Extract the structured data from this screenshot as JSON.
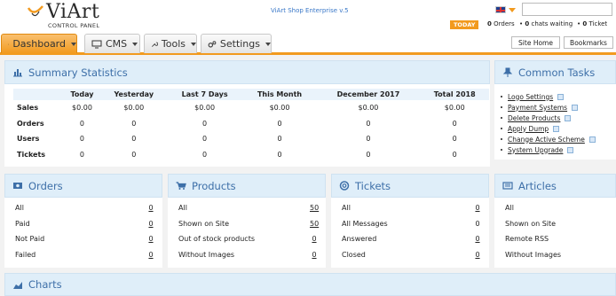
{
  "header": {
    "logo_text": "ViArt",
    "logo_sub": "CONTROL PANEL",
    "edition": "ViArt Shop Enterprise v.5",
    "search_placeholder": "",
    "today_badge": "TODAY",
    "orders_count": "0",
    "orders_label": "Orders",
    "chats_count": "0",
    "chats_label": "chats waiting",
    "tickets_count": "0",
    "tickets_label": "Ticket",
    "site_home": "Site Home",
    "bookmarks": "Bookmarks",
    "accent_color": "#f29a1e"
  },
  "nav": {
    "tabs": [
      {
        "label": "Dashboard",
        "icon": "home-icon"
      },
      {
        "label": "CMS",
        "icon": "monitor-icon"
      },
      {
        "label": "Tools",
        "icon": "wrench-icon"
      },
      {
        "label": "Settings",
        "icon": "gears-icon"
      }
    ]
  },
  "summary": {
    "title": "Summary Statistics",
    "columns": [
      "Today",
      "Yesterday",
      "Last 7 Days",
      "This Month",
      "December 2017",
      "Total 2018"
    ],
    "rows": [
      {
        "label": "Sales",
        "values": [
          "$0.00",
          "$0.00",
          "$0.00",
          "$0.00",
          "$0.00",
          "$0.00"
        ]
      },
      {
        "label": "Orders",
        "values": [
          "0",
          "0",
          "0",
          "0",
          "0",
          "0"
        ]
      },
      {
        "label": "Users",
        "values": [
          "0",
          "0",
          "0",
          "0",
          "0",
          "0"
        ]
      },
      {
        "label": "Tickets",
        "values": [
          "0",
          "0",
          "0",
          "0",
          "0",
          "0"
        ]
      }
    ]
  },
  "tasks": {
    "title": "Common Tasks",
    "items": [
      "Logo Settings",
      "Payment Systems",
      "Delete Products",
      "Apply Dump",
      "Change Active Scheme",
      "System Upgrade"
    ]
  },
  "orders": {
    "title": "Orders",
    "rows": [
      {
        "label": "All",
        "value": "0"
      },
      {
        "label": "Paid",
        "value": "0"
      },
      {
        "label": "Not Paid",
        "value": "0"
      },
      {
        "label": "Failed",
        "value": "0"
      }
    ]
  },
  "products": {
    "title": "Products",
    "rows": [
      {
        "label": "All",
        "value": "50"
      },
      {
        "label": "Shown on Site",
        "value": "50"
      },
      {
        "label": "Out of stock products",
        "value": "0"
      },
      {
        "label": "Without Images",
        "value": "0"
      }
    ]
  },
  "tickets": {
    "title": "Tickets",
    "rows": [
      {
        "label": "All",
        "value": "0"
      },
      {
        "label": "All Messages",
        "value": "0"
      },
      {
        "label": "Answered",
        "value": "0"
      },
      {
        "label": "Closed",
        "value": "0"
      }
    ]
  },
  "articles": {
    "title": "Articles",
    "rows": [
      {
        "label": "All"
      },
      {
        "label": "Shown on Site"
      },
      {
        "label": "Remote RSS"
      },
      {
        "label": "Without Images"
      }
    ]
  },
  "charts": {
    "title": "Charts"
  }
}
